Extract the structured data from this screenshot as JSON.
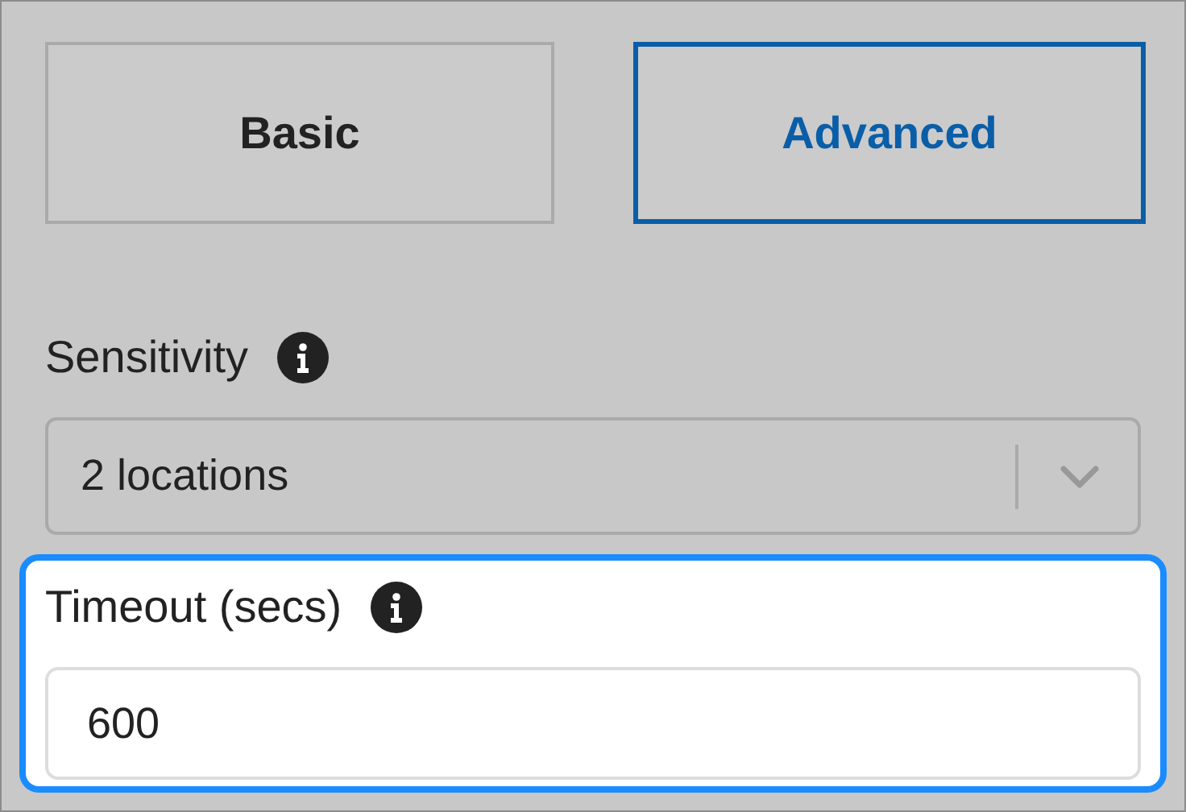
{
  "tabs": [
    {
      "label": "Basic",
      "selected": false
    },
    {
      "label": "Advanced",
      "selected": true
    }
  ],
  "fields": [
    {
      "kind": "select",
      "label": "Sensitivity",
      "value": "2 locations",
      "highlighted": false
    },
    {
      "kind": "input",
      "label": "Timeout (secs)",
      "value": "600",
      "highlighted": true
    }
  ]
}
